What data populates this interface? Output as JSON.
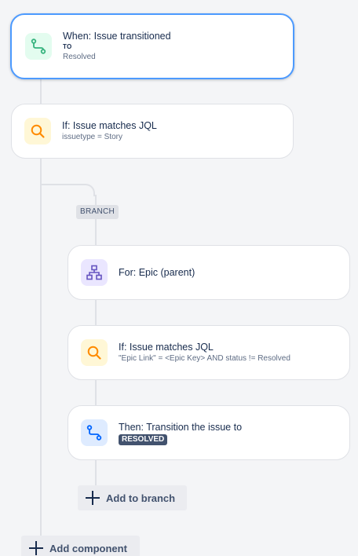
{
  "colors": {
    "trigger_icon": "#36b37e",
    "condition_icon": "#ff8b00",
    "branch_icon": "#6554c0",
    "action_icon": "#0065ff",
    "selected_border": "#4c9aff",
    "lozenge_bg": "#42526e"
  },
  "trigger": {
    "icon": "transition-icon",
    "title": "When: Issue transitioned",
    "to_label": "TO",
    "status": "Resolved"
  },
  "condition1": {
    "icon": "search-icon",
    "title": "If: Issue matches JQL",
    "query": "issuetype = Story"
  },
  "branch": {
    "tag": "BRANCH",
    "for_card": {
      "icon": "hierarchy-icon",
      "title": "For: Epic (parent)"
    },
    "condition": {
      "icon": "search-icon",
      "title": "If: Issue matches JQL",
      "query": "\"Epic Link\" = <Epic Key> AND status != Resolved"
    },
    "action": {
      "icon": "transition-icon",
      "title": "Then: Transition the issue to",
      "status": "RESOLVED"
    },
    "add_label": "Add to branch"
  },
  "add_component_label": "Add component"
}
